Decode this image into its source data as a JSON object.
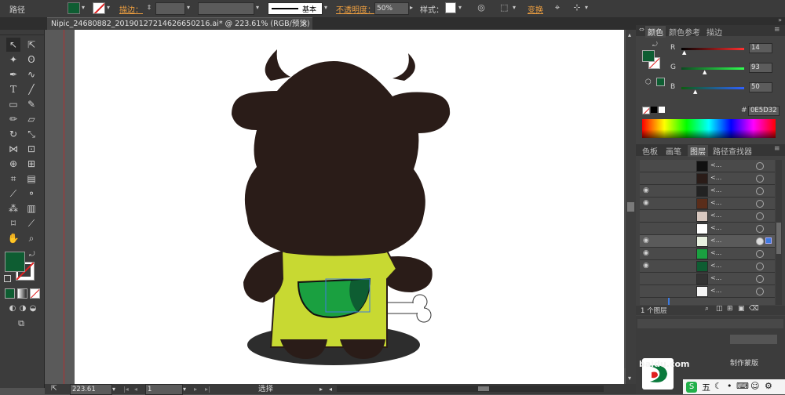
{
  "control_bar": {
    "path_label": "路径",
    "stroke_label": "描边：",
    "stroke_style": "基本",
    "opacity_label": "不透明度：",
    "opacity_value": "50%",
    "style_label": "样式：",
    "transform_label": "变换"
  },
  "document": {
    "tab_title": "Nipic_24680882_20190127214626650216.ai* @ 223.61% (RGB/预览)",
    "close_glyph": "×"
  },
  "status_bar": {
    "zoom": "223.61",
    "artboard_number": "1",
    "tool_name": "选择"
  },
  "color_panel": {
    "tabs": [
      "颜色",
      "颜色参考",
      "描边"
    ],
    "r_value": "14",
    "g_value": "93",
    "b_value": "50",
    "r_label": "R",
    "g_label": "G",
    "b_label": "B",
    "hex_label": "#",
    "hex_value": "0E5D32"
  },
  "layers_panel": {
    "tabs": [
      "色板",
      "画笔",
      "图层",
      "路径查找器"
    ],
    "row_label": "<...",
    "footer": "1 个图层"
  },
  "watermark": {
    "baidu_text": "baidu.com",
    "make_mask": "制作蒙版"
  },
  "taskbar": {
    "input_char": "五"
  },
  "colors": {
    "fill_green": "#0E5D32",
    "bull_dark": "#2a1c18",
    "shirt_yellow": "#c8d932",
    "pocket_green": "#1aa040",
    "accent_orange": "#f0a040"
  }
}
